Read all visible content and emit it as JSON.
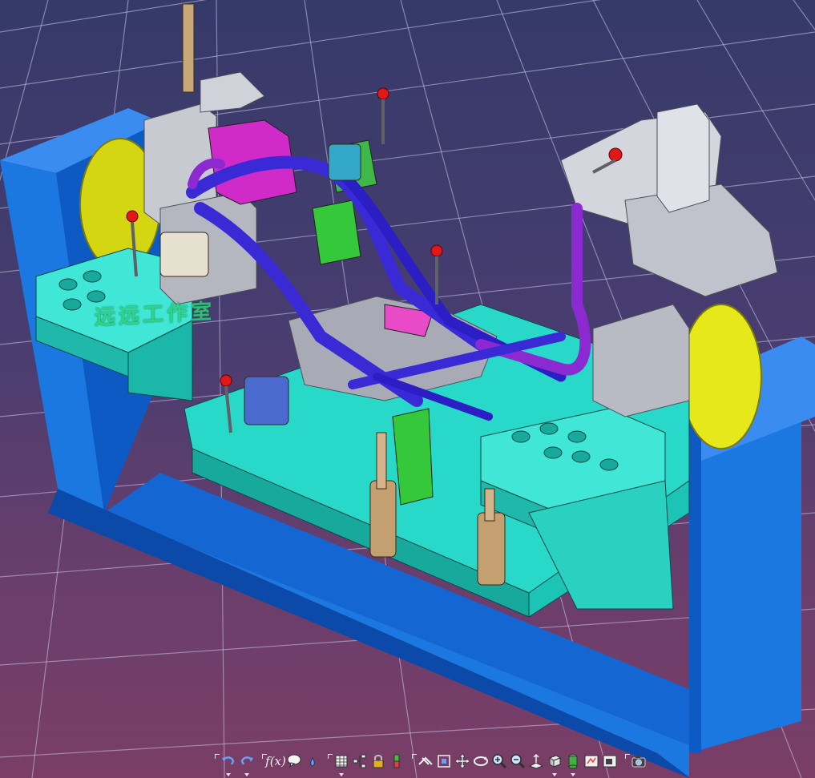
{
  "watermark": {
    "text": "远远工作室"
  },
  "colors": {
    "frame": "#1a78e0",
    "frame_dark": "#0d4fb0",
    "base": "#28d8c8",
    "base_dark": "#17a99c",
    "tube": "#3a2ad6",
    "magenta": "#d02ac8",
    "purple": "#8a2ad0",
    "grey": "#c8cad2",
    "yellow": "#e6e81a",
    "green": "#34c83a",
    "red_knob": "#e01818"
  },
  "toolbar": {
    "groups": [
      {
        "name": "undo-redo",
        "buttons": [
          {
            "icon": "undo-icon",
            "dropdown": true
          },
          {
            "icon": "redo-icon",
            "dropdown": true
          }
        ]
      },
      {
        "name": "knowledge",
        "buttons": [
          {
            "icon": "formula-fx-icon",
            "label": "f(x)"
          },
          {
            "icon": "comment-icon"
          },
          {
            "icon": "drop-icon",
            "dropdown": false
          }
        ]
      },
      {
        "name": "tools",
        "buttons": [
          {
            "icon": "table-icon",
            "dropdown": true
          },
          {
            "icon": "tree-icon"
          },
          {
            "icon": "lock-icon"
          },
          {
            "icon": "ruler-icon"
          }
        ]
      },
      {
        "name": "view",
        "buttons": [
          {
            "icon": "fly-mode-icon"
          },
          {
            "icon": "fit-all-icon"
          },
          {
            "icon": "pan-icon"
          },
          {
            "icon": "rotate-icon"
          },
          {
            "icon": "zoom-in-icon"
          },
          {
            "icon": "zoom-out-icon"
          },
          {
            "icon": "normal-view-icon"
          },
          {
            "icon": "iso-view-icon",
            "dropdown": true
          },
          {
            "icon": "shading-icon",
            "dropdown": true
          },
          {
            "icon": "hide-show-icon"
          },
          {
            "icon": "swap-visible-icon"
          }
        ]
      },
      {
        "name": "capture",
        "buttons": [
          {
            "icon": "camera-icon"
          }
        ]
      }
    ]
  }
}
